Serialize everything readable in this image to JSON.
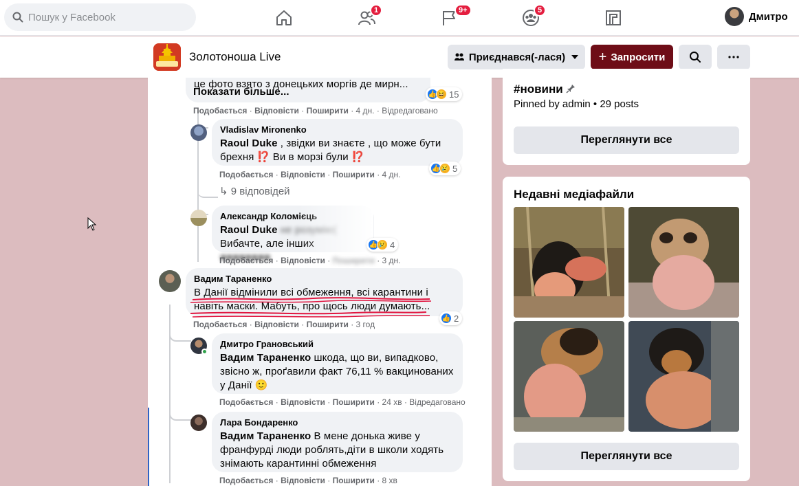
{
  "topbar": {
    "search_placeholder": "Пошук у Facebook",
    "badges": {
      "friends": "1",
      "pages": "9+",
      "groups": "5"
    },
    "profile_name": "Дмитро"
  },
  "group": {
    "name": "Золотоноша Live",
    "joined_label": "Приєднався(-лася)",
    "invite_label": "Запросити"
  },
  "comments": {
    "c0": {
      "text_line": "це фото взято з донецьких моргів де мирн...",
      "see_more": "Показати більше...",
      "reactions": "15",
      "like": "Подобається",
      "reply": "Відповісти",
      "share": "Поширити",
      "time": "4 дн.",
      "edited": "Відредаговано"
    },
    "c1": {
      "author": "Vladislav Mironenko",
      "mention": "Raoul Duke",
      "text1": " , звідки ви знаєте , що може бути",
      "text2": "брехня ⁉️ Ви в морзі були ⁉️",
      "reactions": "5",
      "like": "Подобається",
      "reply": "Відповісти",
      "share": "Поширити",
      "time": "4 дн."
    },
    "replies": "9 відповідей",
    "c2": {
      "author": "Александр Коломієць",
      "mention": "Raoul Duke",
      "text1": " не розумію(",
      "text2": "Вибачте, але інших",
      "reactions": "4",
      "like": "Подобається",
      "reply": "Відповісти",
      "share": "Поширити",
      "time": "3 дн."
    },
    "c3": {
      "author": "Вадим Тараненко",
      "text1": "В Данії відмінили всі обмеження, всі карантини і",
      "text2": "навіть маски. Мабуть, про щось люди думають...",
      "reactions": "2",
      "like": "Подобається",
      "reply": "Відповісти",
      "share": "Поширити",
      "time": "3 год"
    },
    "c4": {
      "author": "Дмитро Грановський",
      "mention": "Вадим Тараненко",
      "text1": " шкода, що ви, випадково,",
      "text2": "звісно ж, проґавили факт 76,11 % вакцинованих",
      "text3": "у Данії 🙂",
      "like": "Подобається",
      "reply": "Відповісти",
      "share": "Поширити",
      "time": "24 хв",
      "edited": "Відредаговано"
    },
    "c5": {
      "author": "Лара Бондаренко",
      "mention": "Вадим Тараненко",
      "text1": " В мене донька живе у",
      "text2": "франфурді люди роблять,діти в школи ходять",
      "text3": "знімають карантинні обмеження",
      "like": "Подобається",
      "reply": "Відповісти",
      "share": "Поширити",
      "time": "8 хв"
    }
  },
  "sidebar": {
    "hashtag": "#новини",
    "pinned": "Pinned by admin • 29 posts",
    "view_all_1": "Переглянути все",
    "media_title": "Недавні медіафайли",
    "view_all_2": "Переглянути все"
  },
  "colors": {
    "accent_blue": "#1877f2",
    "invite_bg": "#6e0d17",
    "page_bg": "#dcbcbf",
    "badge": "#e41e3f"
  },
  "icons": [
    "search-icon",
    "home-icon",
    "friends-icon",
    "pages-flag-icon",
    "groups-icon",
    "gaming-icon",
    "people-icon",
    "caret-down-icon",
    "plus-icon",
    "magnifier-icon",
    "more-dots-icon",
    "pin-icon",
    "reply-arrow-icon",
    "like-icon",
    "haha-icon",
    "sad-icon",
    "mouse-cursor-icon"
  ]
}
